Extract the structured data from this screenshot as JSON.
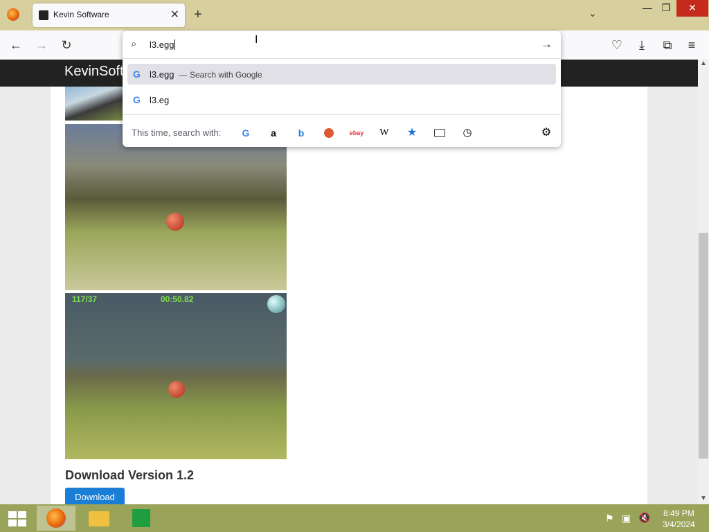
{
  "browser": {
    "tab_title": "Kevin Software",
    "url_value": "l3.egg",
    "suggestions": [
      {
        "text": "l3.egg",
        "suffix": "— Search with Google"
      },
      {
        "text": "l3.eg",
        "suffix": ""
      }
    ],
    "search_with_label": "This time, search with:",
    "engines": [
      "google",
      "amazon",
      "bing",
      "duckduckgo",
      "ebay",
      "wikipedia",
      "bookmarks",
      "tabs",
      "history"
    ]
  },
  "site": {
    "header": "KevinSoft",
    "download_heading": "Download Version 1.2",
    "download_button": "Download"
  },
  "game_hud": {
    "score": "117/37",
    "timer": "00:50.82"
  },
  "taskbar": {
    "time": "8:49 PM",
    "date": "3/4/2024"
  },
  "colors": {
    "accent": "#1a7dd6",
    "tabbar": "#d7cf9e"
  }
}
